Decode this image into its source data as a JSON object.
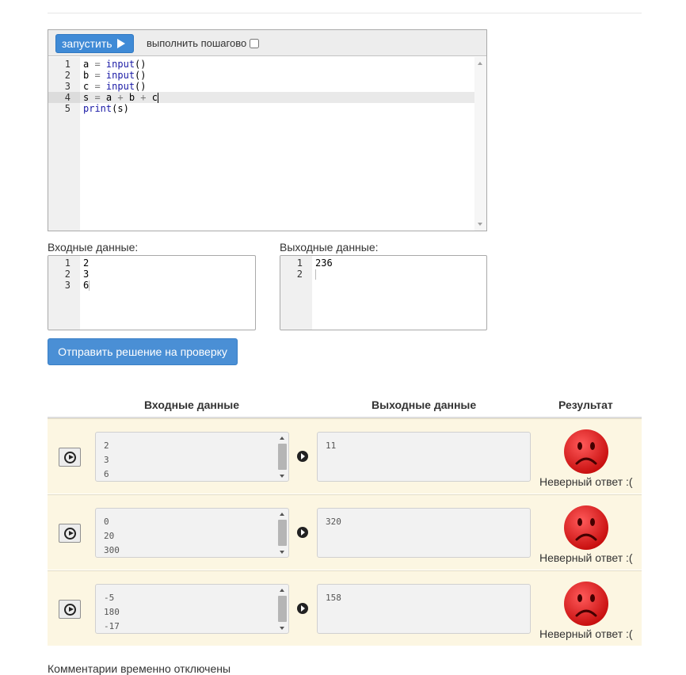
{
  "editor": {
    "run_label": "запустить",
    "step_label": "выполнить пошагово",
    "code_lines": [
      {
        "n": "1",
        "text": "a = input()"
      },
      {
        "n": "2",
        "text": "b = input()"
      },
      {
        "n": "3",
        "text": "c = input()"
      },
      {
        "n": "4",
        "text": "s = a + b + c"
      },
      {
        "n": "5",
        "text": "print(s)"
      }
    ]
  },
  "input_panel": {
    "label": "Входные данные:",
    "lines": [
      {
        "n": "1",
        "text": "2"
      },
      {
        "n": "2",
        "text": "3"
      },
      {
        "n": "3",
        "text": "6"
      }
    ]
  },
  "output_panel": {
    "label": "Выходные данные:",
    "lines": [
      {
        "n": "1",
        "text": "236"
      },
      {
        "n": "2",
        "text": ""
      }
    ]
  },
  "submit_label": "Отправить решение на проверку",
  "results": {
    "headers": {
      "input": "Входные данные",
      "output": "Выходные данные",
      "result": "Результат"
    },
    "rows": [
      {
        "input": [
          "2",
          "3",
          "6"
        ],
        "output": "11",
        "verdict": "Неверный ответ :("
      },
      {
        "input": [
          "0",
          "20",
          "300"
        ],
        "output": "320",
        "verdict": "Неверный ответ :("
      },
      {
        "input": [
          "-5",
          "180",
          "-17"
        ],
        "output": "158",
        "verdict": "Неверный ответ :("
      }
    ]
  },
  "comment_label": "Комментарии временно отключены",
  "colors": {
    "run_button": "#3f8ad6",
    "submit_button": "#4a8fd5",
    "row_background": "#fcf6e2",
    "sad_face": "#e31b1b"
  },
  "icons": {
    "run": "play-triangle-icon",
    "test_run": "play-circle-icon",
    "arrow": "arrow-right-circle-icon",
    "result": "sad-face-icon"
  }
}
